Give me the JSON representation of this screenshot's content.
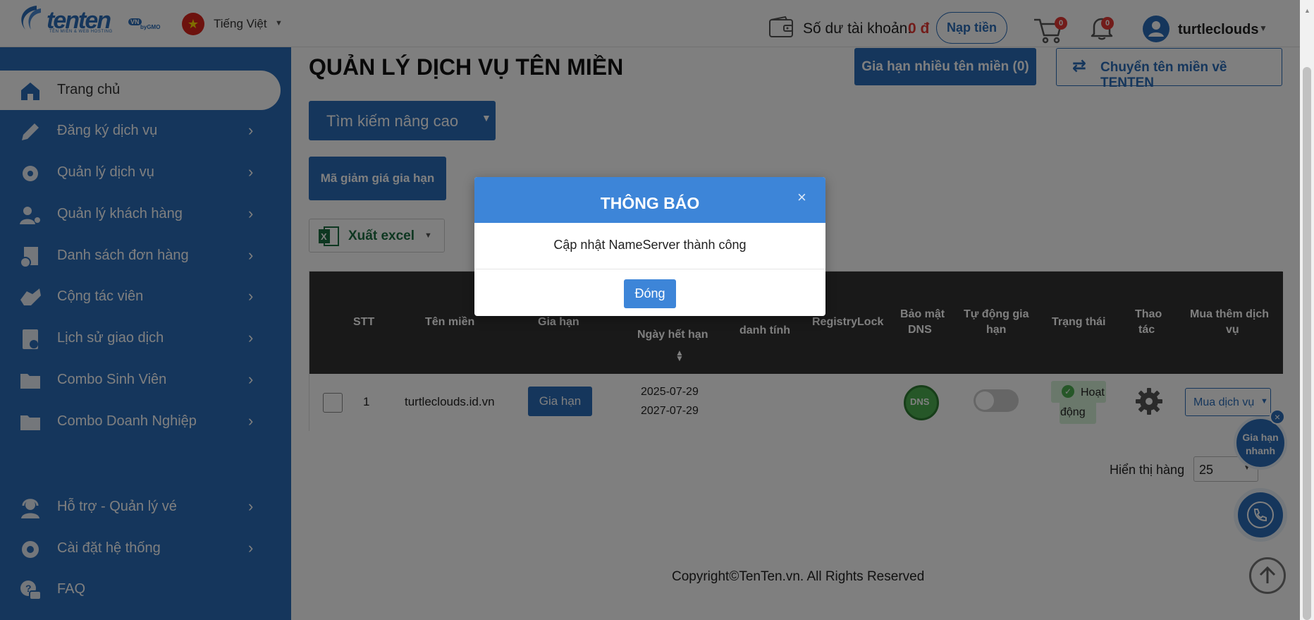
{
  "header": {
    "logo_text": "tenten",
    "logo_sub": "TÊN MIỀN & WEB HOSTING",
    "logo_vn": "VN",
    "logo_gmo": "byGMO",
    "language": "Tiếng Việt",
    "balance_label": "Số dư tài khoản:",
    "balance_value": "0 đ",
    "topup_label": "Nạp tiền",
    "cart_count": "0",
    "notification_count": "0",
    "username": "turtleclouds"
  },
  "sidebar": {
    "items": [
      {
        "label": "Trang chủ"
      },
      {
        "label": "Đăng ký dịch vụ"
      },
      {
        "label": "Quản lý dịch vụ"
      },
      {
        "label": "Quản lý khách hàng"
      },
      {
        "label": "Danh sách đơn hàng"
      },
      {
        "label": "Cộng tác viên"
      },
      {
        "label": "Lịch sử giao dịch"
      },
      {
        "label": "Combo Sinh Viên"
      },
      {
        "label": "Combo Doanh Nghiệp"
      },
      {
        "label": "Hỗ trợ - Quản lý vé"
      },
      {
        "label": "Cài đặt hệ thống"
      },
      {
        "label": "FAQ"
      }
    ]
  },
  "main": {
    "title": "QUẢN LÝ DỊCH VỤ TÊN MIỀN",
    "renew_many_label": "Gia hạn nhiều tên miền (0)",
    "transfer_label": "Chuyển tên miền về TENTEN",
    "advanced_search_label": "Tìm kiếm nâng cao",
    "coupon_label": "Mã giảm giá gia hạn",
    "export_label": "Xuất excel",
    "table": {
      "headers": {
        "stt": "STT",
        "domain": "Tên miền",
        "renew": "Gia hạn",
        "expiry": "Ngày hết hạn",
        "identity": "danh tính",
        "registrylock": "RegistryLock",
        "dns_security_1": "Bảo mật",
        "dns_security_2": "DNS",
        "auto_renew_1": "Tự động gia",
        "auto_renew_2": "hạn",
        "status": "Trạng thái",
        "action_1": "Thao",
        "action_2": "tác",
        "buy_more_1": "Mua thêm dịch",
        "buy_more_2": "vụ"
      },
      "rows": [
        {
          "stt": "1",
          "domain": "turtleclouds.id.vn",
          "renew_button": "Gia hạn",
          "start_date": "2025-07-29",
          "expiry_date": "2027-07-29",
          "dns_badge": "DNS",
          "auto_renew": false,
          "status_1": "Hoạt",
          "status_2": "động",
          "buy_button": "Mua dịch vụ"
        }
      ]
    },
    "rows_per_page_label": "Hiển thị hàng",
    "rows_per_page_value": "25",
    "copyright": "Copyright©TenTen.vn. All Rights Reserved"
  },
  "floating": {
    "quick_renew_line1": "Gia hạn",
    "quick_renew_line2": "nhanh"
  },
  "modal": {
    "title": "THÔNG BÁO",
    "message": "Cập nhật NameServer thành công",
    "close_button": "Đóng"
  },
  "colors": {
    "brand_blue": "#2b6db9",
    "modal_blue": "#3d85d8",
    "table_header": "#333333",
    "balance_red": "#e53935"
  }
}
